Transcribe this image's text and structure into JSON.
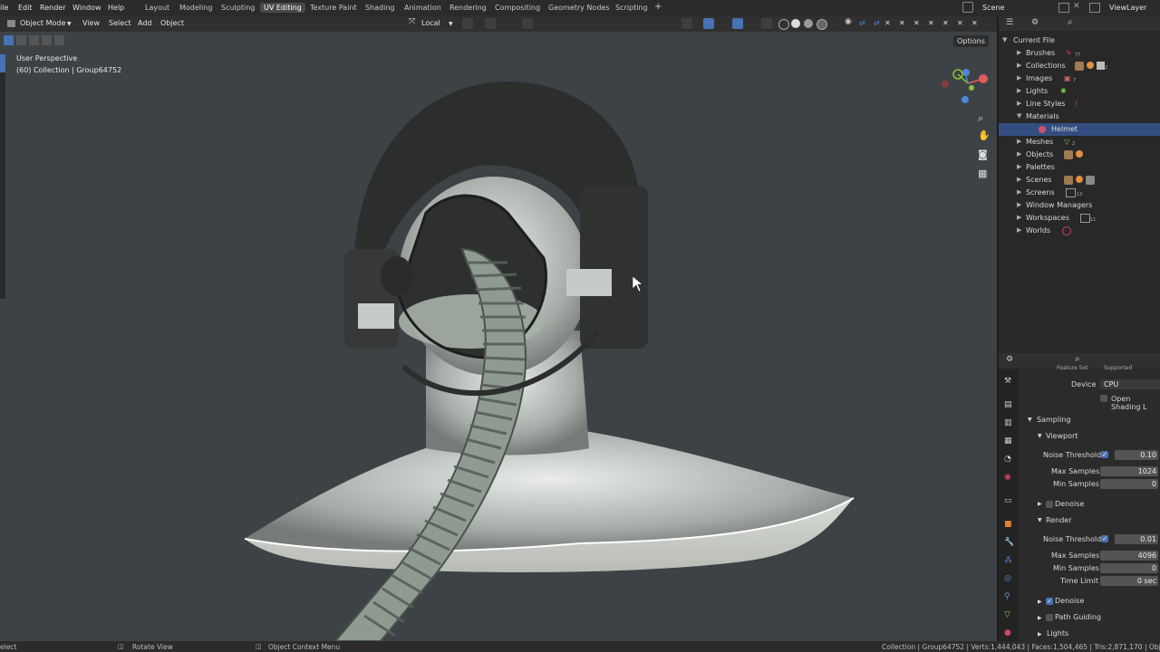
{
  "menu": {
    "file": "ile",
    "edit": "Edit",
    "render": "Render",
    "window": "Window",
    "help": "Help"
  },
  "workspaces": [
    "Layout",
    "Modeling",
    "Sculpting",
    "UV Editing",
    "Texture Paint",
    "Shading",
    "Animation",
    "Rendering",
    "Compositing",
    "Geometry Nodes",
    "Scripting"
  ],
  "top_right": {
    "scene": "Scene",
    "view_layer": "ViewLayer"
  },
  "viewport_header": {
    "mode": "Object Mode",
    "view": "View",
    "select": "Select",
    "add": "Add",
    "object": "Object",
    "orientation": "Local",
    "options": "Options"
  },
  "viewport_overlay": {
    "perspective": "User Perspective",
    "collection": "(60) Collection | Group64752"
  },
  "outliner": {
    "root": "Current File",
    "items": [
      "Brushes",
      "Collections",
      "Images",
      "Lights",
      "Line Styles",
      "Materials",
      "Helmet",
      "Meshes",
      "Objects",
      "Palettes",
      "Scenes",
      "Screens",
      "Window Managers",
      "Workspaces",
      "Worlds"
    ],
    "counts": {
      "brushes": "77",
      "collections": "2",
      "images": "7",
      "meshes": "2",
      "screens": "13",
      "workspaces": "11"
    }
  },
  "properties": {
    "feature_set_label": "Feature Set",
    "feature_set_value": "Supported",
    "device_label": "Device",
    "device_value": "CPU",
    "open_shading": "Open Shading L",
    "sampling": "Sampling",
    "viewport": "Viewport",
    "noise_threshold": "Noise Threshold",
    "vp_noise_value": "0.10",
    "max_samples": "Max Samples",
    "vp_max_value": "1024",
    "min_samples": "Min Samples",
    "vp_min_value": "0",
    "denoise": "Denoise",
    "render": "Render",
    "r_noise_value": "0.01",
    "r_max_value": "4096",
    "r_min_value": "0",
    "time_limit": "Time Limit",
    "time_limit_value": "0 sec",
    "path_guiding": "Path Guiding",
    "lights": "Lights"
  },
  "statusbar": {
    "select": "elect",
    "rotate": "Rotate View",
    "context": "Object Context Menu",
    "stats": "Collection | Group64752 | Verts:1,444,043 | Faces:1,504,465 | Tris:2,871,170 | Obj"
  },
  "colors": {
    "accent": "#4772b3",
    "selection": "#334d80",
    "viewport_bg": "#3d4246"
  }
}
